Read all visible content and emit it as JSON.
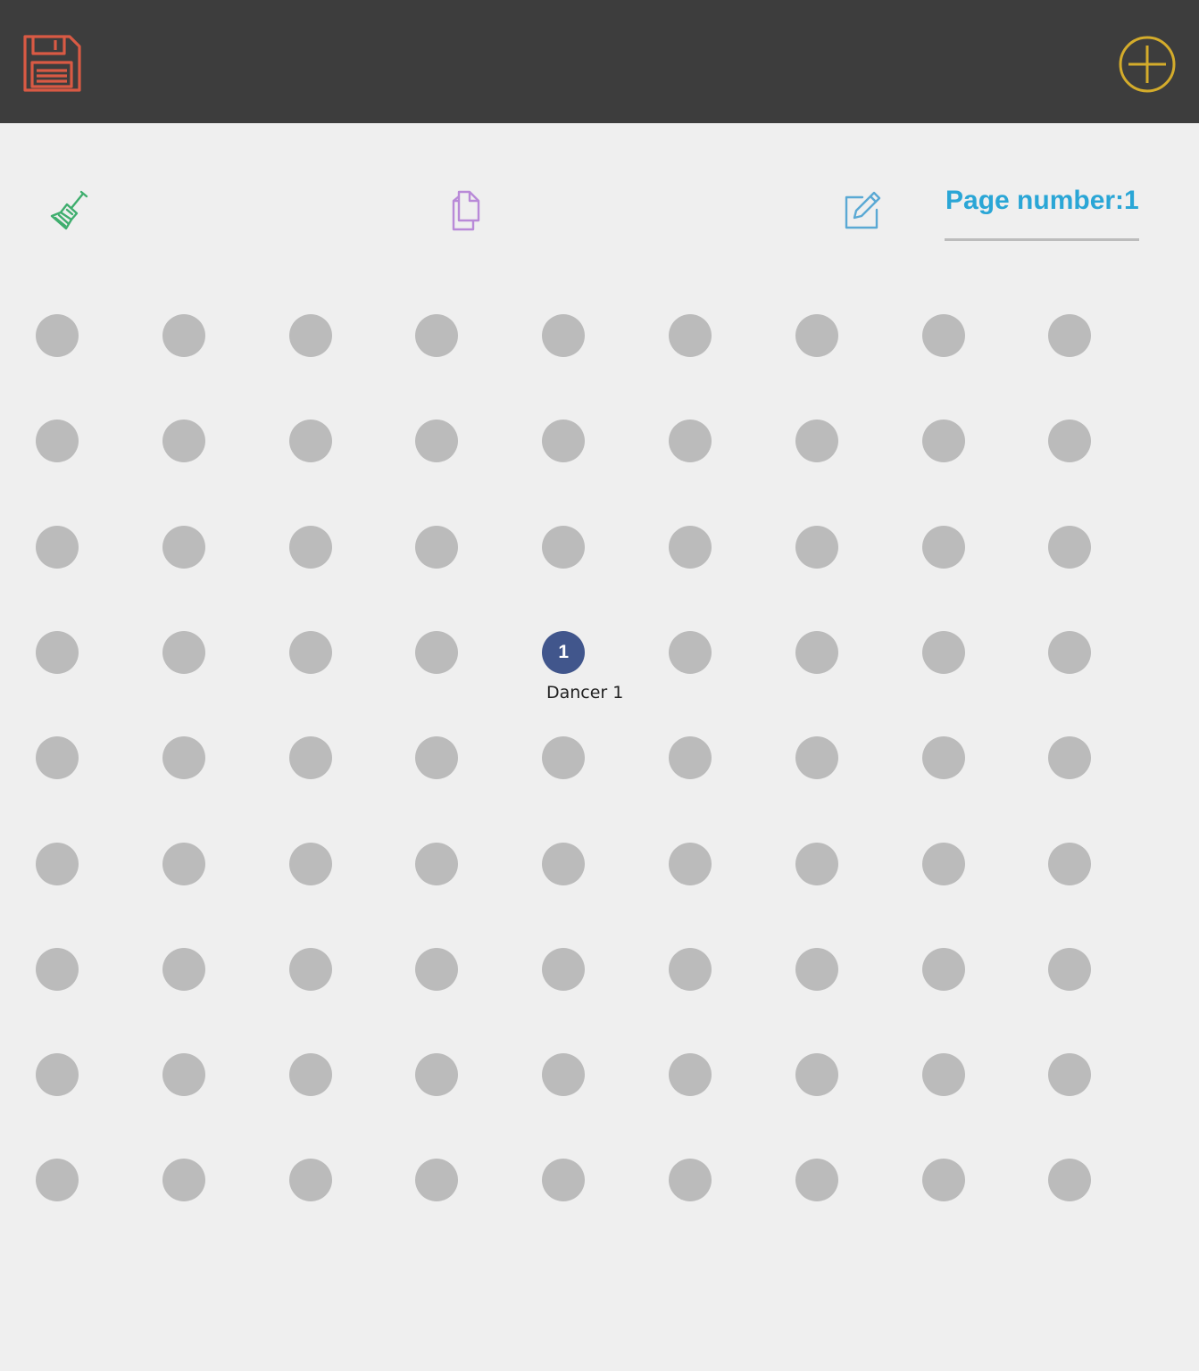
{
  "header": {
    "save_icon": "floppy-disk-icon",
    "save_color": "#d95a44",
    "add_icon": "plus-circle-icon",
    "add_color": "#d4ac2b",
    "background": "#3d3d3d"
  },
  "toolbar": {
    "clear_icon": "broom-icon",
    "clear_color": "#3fae6e",
    "copy_icon": "copy-pages-icon",
    "copy_color": "#b98ad8",
    "edit_icon": "edit-pencil-icon",
    "edit_color": "#5aa9d4",
    "page_number_text": "Page number:1"
  },
  "stage_grid": {
    "rows": 9,
    "columns": 9,
    "dot_color": "#bbbbbb"
  },
  "dancers": [
    {
      "number": "1",
      "label": "Dancer 1",
      "row": 4,
      "column": 5,
      "color": "#41568c"
    }
  ]
}
